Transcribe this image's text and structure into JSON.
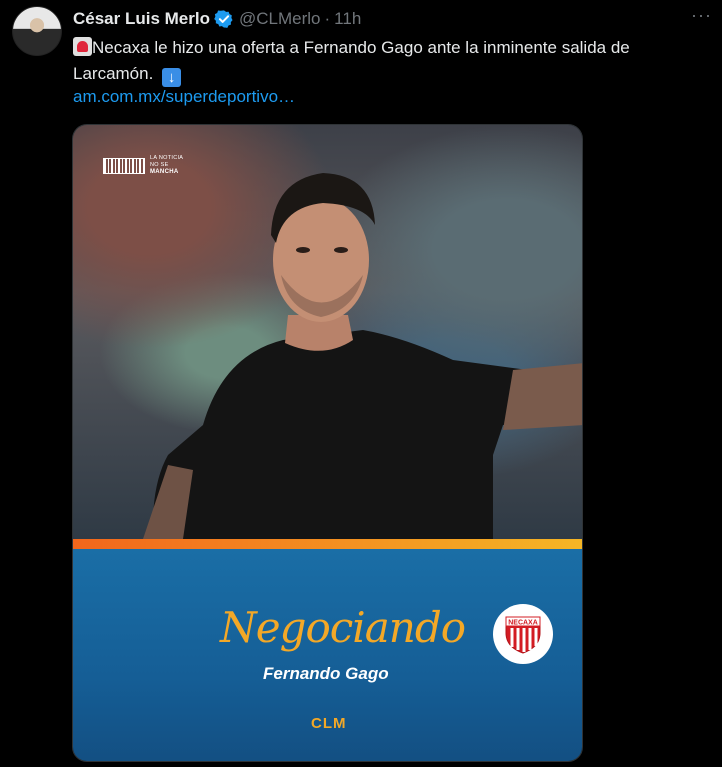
{
  "tweet": {
    "author_name": "César Luis Merlo",
    "handle": "@CLMerlo",
    "separator": "·",
    "time": "11h",
    "more_label": "···",
    "text": "Necaxa le hizo una oferta a Fernando Gago ante la inminente salida de Larcamón.",
    "link_text": "am.com.mx/superdeportivo…"
  },
  "media": {
    "brand_line1": "LA NOTICIA",
    "brand_line2": "NO SE",
    "brand_line3": "MANCHA",
    "title": "Negociando",
    "subtitle": "Fernando Gago",
    "crest_label": "NECAXA",
    "logo_text": "CLM"
  },
  "colors": {
    "background": "#000000",
    "link": "#1d9bf0",
    "verified": "#1d9bf0",
    "accent_orange": "#f3a827",
    "banner_blue": "#155e96"
  },
  "icons": [
    "verified-badge-icon",
    "rotating-light-emoji",
    "down-arrow-emoji",
    "more-icon"
  ]
}
